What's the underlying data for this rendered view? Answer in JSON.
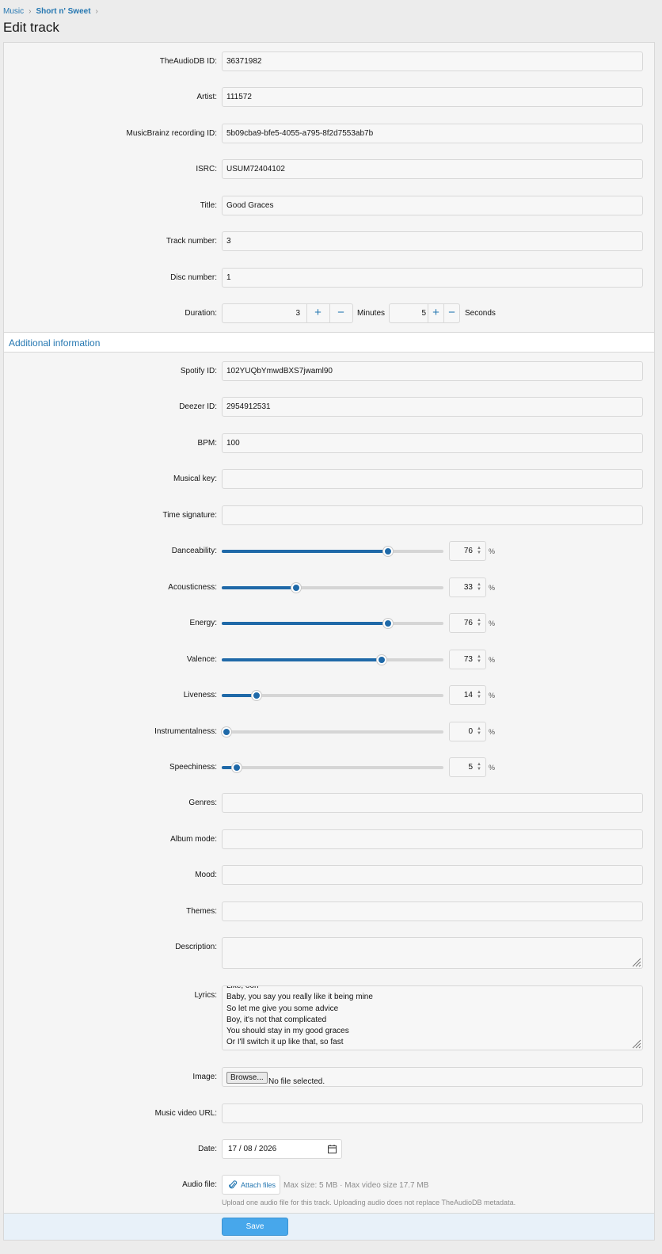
{
  "breadcrumb": [
    {
      "label": "Music"
    },
    {
      "label": "Short n' Sweet"
    }
  ],
  "page_title": "Edit track",
  "fields": {
    "theaudiodb_id": {
      "label": "TheAudioDB ID:",
      "value": "36371982"
    },
    "artist": {
      "label": "Artist:",
      "value": "111572"
    },
    "musicbrainz_id": {
      "label": "MusicBrainz recording ID:",
      "value": "5b09cba9-bfe5-4055-a795-8f2d7553ab7b"
    },
    "isrc": {
      "label": "ISRC:",
      "value": "USUM72404102"
    },
    "title": {
      "label": "Title:",
      "value": "Good Graces"
    },
    "track_number": {
      "label": "Track number:",
      "value": "3"
    },
    "disc_number": {
      "label": "Disc number:",
      "value": "1"
    }
  },
  "duration": {
    "label": "Duration:",
    "minutes": "3",
    "minutes_unit": "Minutes",
    "seconds": "5",
    "seconds_unit": "Seconds",
    "plus_symbol": "+",
    "minus_symbol": "−"
  },
  "section": {
    "title": "Additional information"
  },
  "additional": {
    "spotify_id": {
      "label": "Spotify ID:",
      "value": "102YUQbYmwdBXS7jwaml90"
    },
    "deezer_id": {
      "label": "Deezer ID:",
      "value": "2954912531"
    },
    "bpm": {
      "label": "BPM:",
      "value": "100"
    },
    "musical_key": {
      "label": "Musical key:",
      "value": ""
    },
    "time_signature": {
      "label": "Time signature:",
      "value": ""
    }
  },
  "sliders": [
    {
      "label": "Danceability:",
      "value": 76,
      "display": "76",
      "unit": "%"
    },
    {
      "label": "Acousticness:",
      "value": 33,
      "display": "33",
      "unit": "%"
    },
    {
      "label": "Energy:",
      "value": 76,
      "display": "76",
      "unit": "%"
    },
    {
      "label": "Valence:",
      "value": 73,
      "display": "73",
      "unit": "%"
    },
    {
      "label": "Liveness:",
      "value": 14,
      "display": "14",
      "unit": "%"
    },
    {
      "label": "Instrumentalness:",
      "value": 0,
      "display": "0",
      "unit": "%"
    },
    {
      "label": "Speechiness:",
      "value": 5,
      "display": "5",
      "unit": "%"
    }
  ],
  "more": {
    "genres": {
      "label": "Genres:",
      "value": ""
    },
    "album_mode": {
      "label": "Album mode:",
      "value": ""
    },
    "mood": {
      "label": "Mood:",
      "value": ""
    },
    "themes": {
      "label": "Themes:",
      "value": ""
    },
    "description": {
      "label": "Description:",
      "value": ""
    }
  },
  "lyrics": {
    "label": "Lyrics:",
    "lines": [
      "Like, ooh",
      "Baby, you say you really like it being mine",
      "So let me give you some advice",
      "Boy, it's not that complicated",
      "You should stay in my good graces",
      "Or I'll switch it up like that, so fast"
    ]
  },
  "image": {
    "label": "Image:",
    "button": "Browse...",
    "status": "No file selected."
  },
  "music_video": {
    "label": "Music video URL:",
    "value": ""
  },
  "date": {
    "label": "Date:",
    "value": "17 / 08 / 2026"
  },
  "audio": {
    "label": "Audio file:",
    "button": "Attach files",
    "meta": "Max size: 5 MB · Max video size 17.7 MB",
    "hint": "Upload one audio file for this track. Uploading audio does not replace TheAudioDB metadata."
  },
  "save_label": "Save",
  "colors": {
    "accent": "#2577b1",
    "slider_fill": "#1f69a8",
    "save_button": "#47a7eb"
  }
}
